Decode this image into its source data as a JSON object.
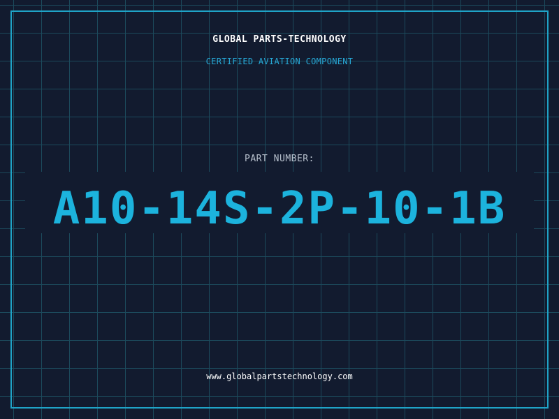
{
  "header": {
    "company": "GLOBAL PARTS-TECHNOLOGY",
    "tagline": "CERTIFIED AVIATION COMPONENT"
  },
  "part": {
    "label": "PART NUMBER:",
    "number": "A10-14S-2P-10-1B"
  },
  "footer": {
    "url": "www.globalpartstechnology.com"
  },
  "colors": {
    "background": "#121b2f",
    "grid": "#1c4a5c",
    "frame": "#1fa3c7",
    "accent": "#1cb3dd",
    "label": "#b7c0cc",
    "text": "#ffffff"
  }
}
